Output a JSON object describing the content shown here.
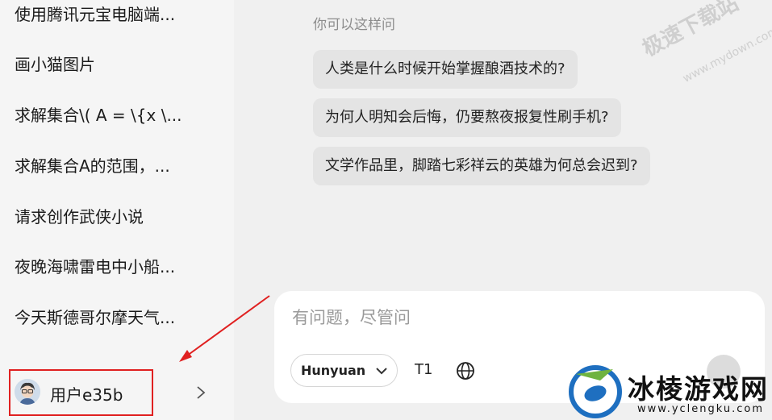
{
  "sidebar": {
    "history": [
      "使用腾讯元宝电脑端...",
      "画小猫图片",
      "求解集合\\( A = \\{x \\...",
      "求解集合A的范围，...",
      "请求创作武侠小说",
      "夜晚海啸雷电中小船...",
      "今天斯德哥尔摩天气..."
    ],
    "user": {
      "name": "用户e35b",
      "avatar_icon": "user-avatar-icon"
    }
  },
  "main": {
    "hint": "你可以这样问",
    "suggestions": [
      "人类是什么时候开始掌握酿酒技术的?",
      "为何人明知会后悔，仍要熬夜报复性刷手机?",
      "文学作品里，脚踏七彩祥云的英雄为何总会迟到?"
    ],
    "input": {
      "placeholder": "有问题，尽管问",
      "value": ""
    },
    "toolbar": {
      "model": "Hunyuan",
      "t1": "T1",
      "web_icon": "globe-icon"
    }
  },
  "watermarks": {
    "top_right": "极速下载站",
    "top_right_url": "www.mydown.com",
    "bottom_brand": "冰棱游戏网",
    "bottom_url": "www.yclengku.com"
  },
  "colors": {
    "highlight": "#e02020",
    "brand_blue": "#1e6fc0"
  }
}
